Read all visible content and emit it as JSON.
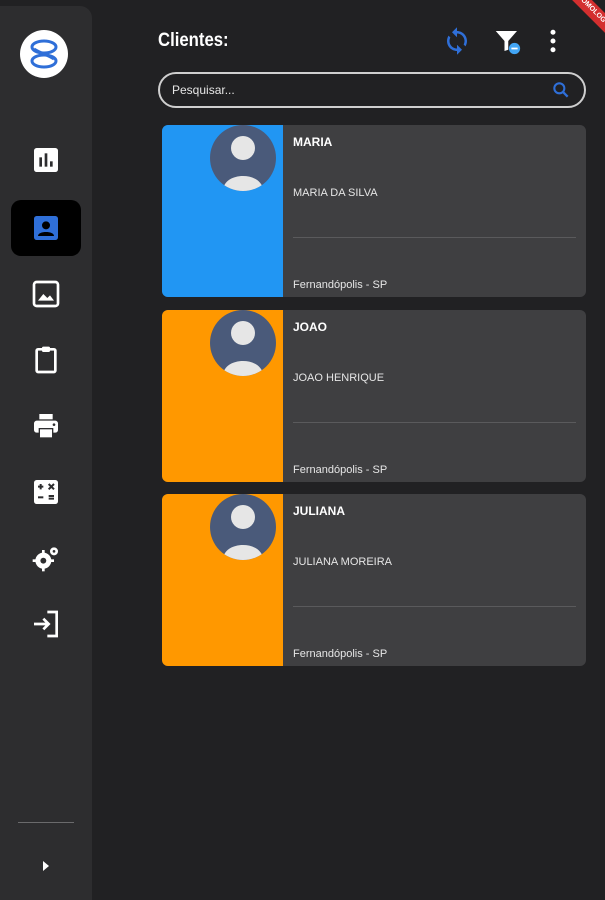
{
  "app": {
    "logo_icon": "app-logo-icon",
    "accent_color": "#2f6fd8",
    "sidebar_active_item": "clientes"
  },
  "sidebar": {
    "items": [
      {
        "id": "reports",
        "icon": "bar-chart-icon"
      },
      {
        "id": "clientes",
        "icon": "contact-icon"
      },
      {
        "id": "images",
        "icon": "image-icon"
      },
      {
        "id": "clipboard",
        "icon": "clipboard-icon"
      },
      {
        "id": "print",
        "icon": "print-icon"
      },
      {
        "id": "calculator",
        "icon": "calculator-icon"
      },
      {
        "id": "settings",
        "icon": "gears-icon"
      },
      {
        "id": "logout",
        "icon": "login-icon"
      }
    ],
    "expand_icon": "chevron-right-icon"
  },
  "header": {
    "title": "Clientes:",
    "sync_icon": "sync-icon",
    "filter_icon": "filter-icon",
    "more_icon": "more-vert-icon"
  },
  "ribbon": {
    "label": "HOMOLOG"
  },
  "search": {
    "placeholder": "Pesquisar..."
  },
  "clients": [
    {
      "name": "MARIA",
      "full_name": "MARIA DA SILVA",
      "city": "Fernandópolis - SP",
      "color": "#2196f3"
    },
    {
      "name": "JOAO",
      "full_name": "JOAO HENRIQUE",
      "city": "Fernandópolis - SP",
      "color": "#ff9800"
    },
    {
      "name": "JULIANA",
      "full_name": "JULIANA MOREIRA",
      "city": "Fernandópolis - SP",
      "color": "#ff9800"
    }
  ]
}
